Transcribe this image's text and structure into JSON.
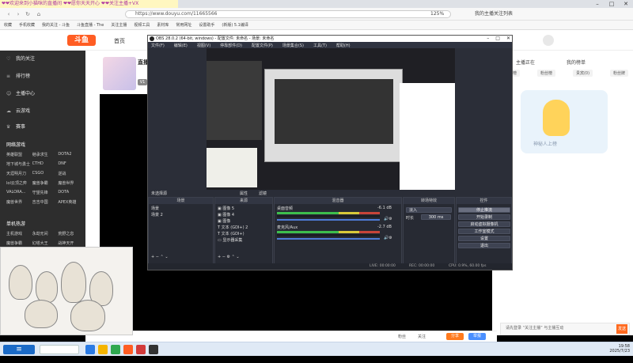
{
  "browser": {
    "promo_text": "❤❤欢迎来到小猫咪的直播间 ❤❤愿你天天开心 ❤❤关注主播+VX",
    "url": "https://www.douyu.com/11665566",
    "zoom": "125%",
    "account": "我的主播关注列表"
  },
  "bookmarks": [
    "收藏",
    "手机收藏",
    "我的关注 - 斗鱼",
    "斗鱼直播 - The",
    "关注主播",
    "视频工具",
    "素材库",
    "常用网址",
    "设置助手",
    "(新版) 5.1编译"
  ],
  "site": {
    "logo": "斗鱼",
    "nav_home": "首页",
    "nav_live": "直播",
    "room_title": "直播",
    "room_tag": "V1"
  },
  "sidebar": {
    "items": [
      "我的关注",
      "排行榜",
      "主播中心",
      "云游戏",
      "赛事"
    ],
    "section1": "网络游戏",
    "games1": [
      "英雄联盟",
      "继承求生",
      "DOTA2",
      "地下城与勇士",
      "CTHD",
      "DNF",
      "天涯明月刀",
      "CSGO",
      "逆战",
      "lol云顶之弈",
      "魔兽争霸",
      "魔兽世界",
      "VALORA...",
      "守望先锋",
      "DOTA",
      "魔兽世界",
      "吉吉中国",
      "APEX英雄"
    ],
    "section2": "单机热游",
    "games2": [
      "主机游戏",
      "永劫无间",
      "荒野之息",
      "魔兽争霸",
      "幻塔大王",
      "战神天开",
      "鬼谷八荒",
      "战神天开",
      "幻兽帕鲁"
    ]
  },
  "right_panel": {
    "hint": "主播正在",
    "rank": "我的榜单",
    "tabs": [
      "贡献榜",
      "粉丝榜",
      "贵宾(0)",
      "粉丝牌"
    ],
    "empty_text": "神秘人上榜",
    "login_hint": "请先登录 “关注主播” 与主播互动",
    "send_label": "发送"
  },
  "bottom_bar": {
    "fans": "粉丝",
    "follow": "关注",
    "share_label": "分享",
    "report_label": "举报"
  },
  "obs": {
    "title": "OBS 28.0.2 (64-bit, windows) - 配置文件: 未命名 - 场景: 未命名",
    "menu": [
      "文件(F)",
      "编辑(E)",
      "视图(V)",
      "停靠部件(D)",
      "配置文件(P)",
      "场景集合(S)",
      "工具(T)",
      "帮助(H)"
    ],
    "active_source": "未选择源",
    "props_label": "属性",
    "filters_label": "滤镜",
    "dock_titles": [
      "场景",
      "来源",
      "混音器",
      "转场特效",
      "控件"
    ],
    "scenes": [
      "场景",
      "场景 2"
    ],
    "sources": [
      "图像 5",
      "图像 4",
      "图像",
      "文本 (GDI+) 2",
      "文本 (GDI+)",
      "显示器采集"
    ],
    "mixer": [
      {
        "name": "桌面音频",
        "db": "-6.1 dB"
      },
      {
        "name": "麦克风/Aux",
        "db": "-2.7 dB"
      }
    ],
    "transition": "淡入",
    "duration_label": "时长",
    "duration": "300 ms",
    "controls": [
      "停止推流",
      "开始录制",
      "启动虚拟摄像机",
      "工作室模式",
      "设置",
      "退出"
    ],
    "status": [
      "LIVE: 00:00:00",
      "REC: 00:00:00",
      "CPU: 0.9%, 60.00 fps"
    ]
  },
  "taskbar": {
    "time": "19:58",
    "date": "2025/7/23"
  }
}
